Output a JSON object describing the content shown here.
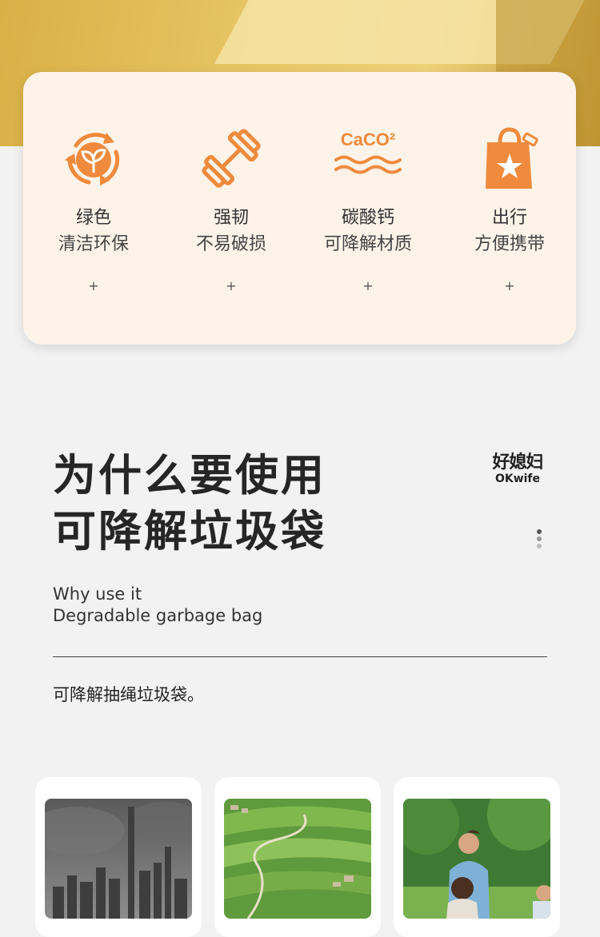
{
  "features": [
    {
      "icon": "recycle-leaf-icon",
      "title": "绿色",
      "subtitle": "清洁环保",
      "plus": "+"
    },
    {
      "icon": "dumbbell-icon",
      "title": "强韧",
      "subtitle": "不易破损",
      "plus": "+"
    },
    {
      "icon": "caco2-icon",
      "icon_text": "CaCO²",
      "title": "碳酸钙",
      "subtitle": "可降解材质",
      "plus": "+"
    },
    {
      "icon": "shopping-bag-icon",
      "title": "出行",
      "subtitle": "方便携带",
      "plus": "+"
    }
  ],
  "headline": {
    "line1": "为什么要使用",
    "line2": "可降解垃圾袋"
  },
  "brand": {
    "cn": "好媳妇",
    "en": "OKwife"
  },
  "subtitle_en": {
    "line1": "Why use it",
    "line2": "Degradable garbage bag"
  },
  "description": "可降解抽绳垃圾袋。",
  "photos": [
    {
      "icon": "polluted-city-photo"
    },
    {
      "icon": "green-terraces-photo"
    },
    {
      "icon": "family-picnic-photo"
    }
  ],
  "colors": {
    "accent": "#f08a3c",
    "card_bg": "#fdf3e8",
    "hero": "#e8c766"
  }
}
